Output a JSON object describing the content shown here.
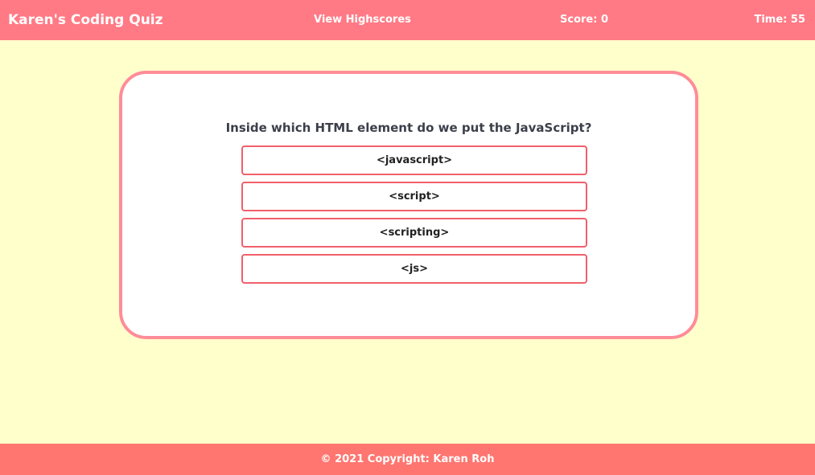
{
  "header": {
    "brand": "Karen's Coding Quiz",
    "highscores_link": "View Highscores",
    "score": "Score: 0",
    "time": "Time: 55"
  },
  "quiz": {
    "question": "Inside which HTML element do we put the JavaScript?",
    "choices": [
      {
        "label": "<javascript>"
      },
      {
        "label": "<script>"
      },
      {
        "label": "<scripting>"
      },
      {
        "label": "<js>"
      }
    ]
  },
  "footer": {
    "copyright": "© 2021 Copyright: Karen Roh"
  },
  "colors": {
    "background": "#ffffcc",
    "header": "#ff7a85",
    "footer": "#ff7670",
    "card_border": "#ff8c98",
    "choice_border": "#f0606a"
  }
}
